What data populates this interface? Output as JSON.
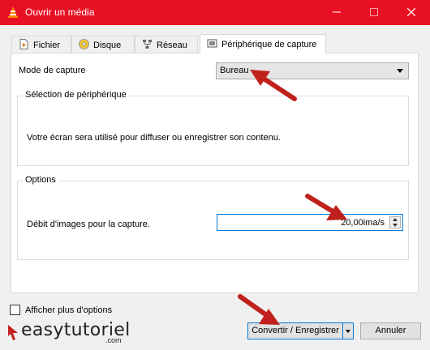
{
  "window": {
    "title": "Ouvrir un média"
  },
  "tabs": [
    {
      "label": "Fichier",
      "icon": "file-icon"
    },
    {
      "label": "Disque",
      "icon": "disc-icon"
    },
    {
      "label": "Réseau",
      "icon": "network-icon"
    },
    {
      "label": "Périphérique de capture",
      "icon": "capture-device-icon",
      "active": true
    }
  ],
  "capture": {
    "mode_label": "Mode de capture",
    "mode_value": "Bureau"
  },
  "device_group": {
    "title": "Sélection de périphérique",
    "description": "Votre écran sera utilisé pour diffuser ou enregistrer son contenu."
  },
  "options_group": {
    "title": "Options",
    "rate_label": "Débit d'images pour la capture.",
    "rate_value": "20,00ima/s"
  },
  "footer": {
    "more_options": "Afficher plus d'options",
    "convert_label": "Convertir / Enregistrer",
    "cancel_label": "Annuler"
  },
  "watermark": {
    "text": "easytutoriel",
    "suffix": ".com"
  },
  "colors": {
    "titlebar": "#e81123",
    "arrow": "#c0211d",
    "focus": "#0078d7"
  }
}
